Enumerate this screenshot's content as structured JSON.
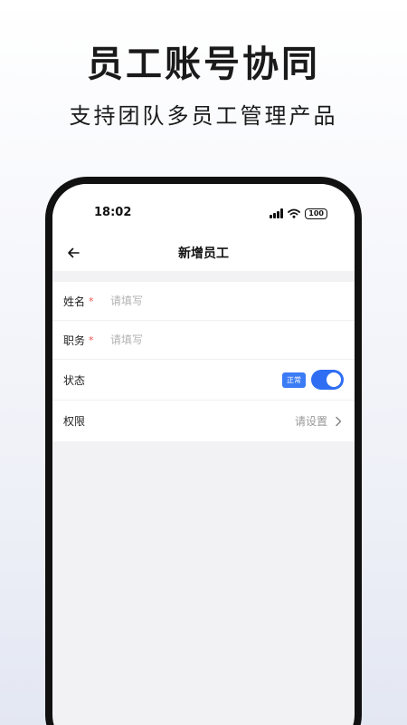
{
  "promo": {
    "title": "员工账号协同",
    "subtitle": "支持团队多员工管理产品"
  },
  "status_bar": {
    "time": "18:02",
    "battery": "100",
    "icons": [
      "signal-icon",
      "wifi-icon",
      "battery-icon"
    ]
  },
  "nav": {
    "title": "新增员工",
    "back_icon": "arrow-left-icon"
  },
  "form": {
    "name": {
      "label": "姓名",
      "required": "*",
      "placeholder": "请填写",
      "value": ""
    },
    "position": {
      "label": "职务",
      "required": "*",
      "placeholder": "请填写",
      "value": ""
    },
    "status": {
      "label": "状态",
      "badge": "正常",
      "enabled": true
    },
    "permission": {
      "label": "权限",
      "value": "请设置",
      "icon": "chevron-right-icon"
    }
  },
  "colors": {
    "accent": "#2f6ef3",
    "badge": "#3b7bf5",
    "required": "#f05050",
    "placeholder": "#b3b3b3"
  }
}
